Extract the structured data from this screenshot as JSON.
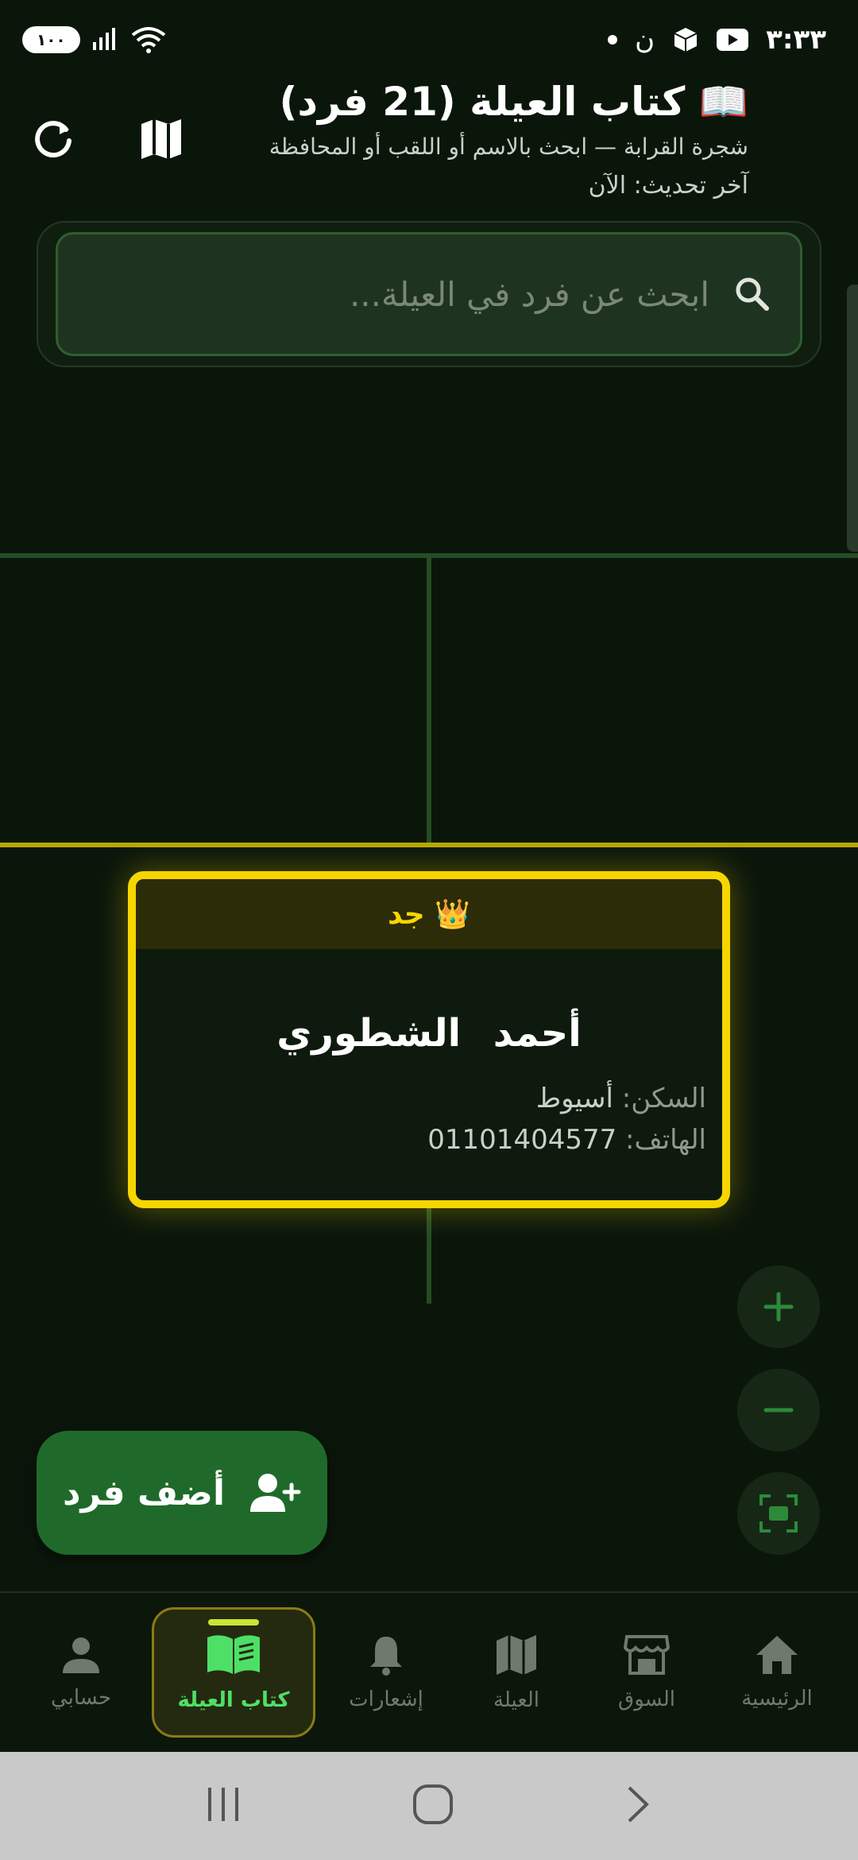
{
  "status_bar": {
    "battery": "١٠٠",
    "time": "٣:٣٣",
    "network_glyph": "ن"
  },
  "header": {
    "title": "📖 كتاب العيلة (21 فرد)",
    "subtitle": "شجرة القرابة — ابحث بالاسم أو اللقب أو المحافظة",
    "last_updated": "آخر تحديث: الآن",
    "refresh_icon": "refresh-icon",
    "map_icon": "map-icon"
  },
  "search": {
    "placeholder": "ابحث عن فرد في العيلة...",
    "value": ""
  },
  "card": {
    "badge": "👑 جد",
    "name": "أحمد الشطوري",
    "residence_label": "السكن:",
    "residence_value": "أسيوط",
    "phone_label": "الهاتف:",
    "phone_value": "01101404577"
  },
  "zoom": {
    "plus": "+",
    "minus": "−"
  },
  "add_button": {
    "label": "أضف فرد"
  },
  "bottom_nav": {
    "items": [
      {
        "label": "الرئيسية",
        "icon": "home-icon"
      },
      {
        "label": "السوق",
        "icon": "store-icon"
      },
      {
        "label": "العيلة",
        "icon": "map-icon"
      },
      {
        "label": "إشعارات",
        "icon": "bell-icon"
      },
      {
        "label": "كتاب العيلة",
        "icon": "book-icon",
        "active": true
      },
      {
        "label": "حسابي",
        "icon": "person-icon"
      }
    ]
  },
  "colors": {
    "background": "#0b160b",
    "accent_green": "#1f6a2a",
    "highlight_yellow": "#f7d600",
    "active_nav_text": "#4ee066"
  }
}
